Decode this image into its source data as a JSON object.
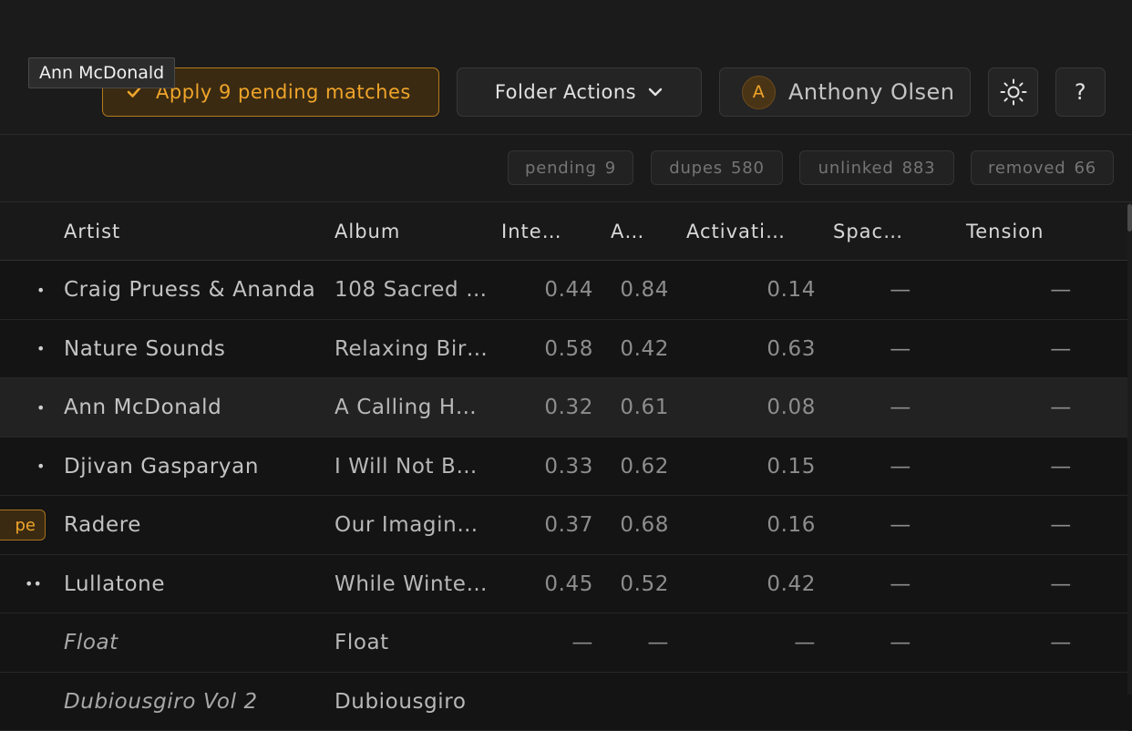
{
  "toolbar": {
    "apply_label": "Apply 9 pending matches",
    "folder_actions_label": "Folder Actions",
    "user_initial": "A",
    "user_name": "Anthony Olsen",
    "help_label": "?",
    "accent_color": "#f0a52a"
  },
  "tooltip": {
    "text": "Ann McDonald"
  },
  "stats": [
    {
      "label": "pending",
      "count": "9"
    },
    {
      "label": "dupes",
      "count": "580"
    },
    {
      "label": "unlinked",
      "count": "883"
    },
    {
      "label": "removed",
      "count": "66"
    }
  ],
  "table": {
    "columns": [
      "Artist",
      "Album",
      "Inte…",
      "A…",
      "Activati…",
      "Spac…",
      "Tension"
    ],
    "rows": [
      {
        "marker": "•",
        "artist": "Craig Pruess & Ananda",
        "album": "108 Sacred …",
        "inte": "0.44",
        "a": "0.84",
        "activation": "0.14",
        "space": "—",
        "tension": "—"
      },
      {
        "marker": "•",
        "artist": "Nature Sounds",
        "album": "Relaxing Bir…",
        "inte": "0.58",
        "a": "0.42",
        "activation": "0.63",
        "space": "—",
        "tension": "—"
      },
      {
        "marker": "•",
        "artist": "Ann McDonald",
        "album": "A Calling H…",
        "inte": "0.32",
        "a": "0.61",
        "activation": "0.08",
        "space": "—",
        "tension": "—"
      },
      {
        "marker": "•",
        "artist": "Djivan Gasparyan",
        "album": "I Will Not B…",
        "inte": "0.33",
        "a": "0.62",
        "activation": "0.15",
        "space": "—",
        "tension": "—"
      },
      {
        "tag": "pe",
        "artist": "Radere",
        "album": "Our Imagin…",
        "inte": "0.37",
        "a": "0.68",
        "activation": "0.16",
        "space": "—",
        "tension": "—"
      },
      {
        "marker": "••",
        "artist": "Lullatone",
        "album": "While Winte…",
        "inte": "0.45",
        "a": "0.52",
        "activation": "0.42",
        "space": "—",
        "tension": "—"
      },
      {
        "marker": "",
        "artist": "Float",
        "album": "Float",
        "inte": "—",
        "a": "—",
        "activation": "—",
        "space": "—",
        "tension": "—"
      },
      {
        "marker": "",
        "artist": "Dubiousgiro Vol 2",
        "album": "Dubiousgiro",
        "inte": "",
        "a": "",
        "activation": "",
        "space": "",
        "tension": ""
      }
    ]
  }
}
